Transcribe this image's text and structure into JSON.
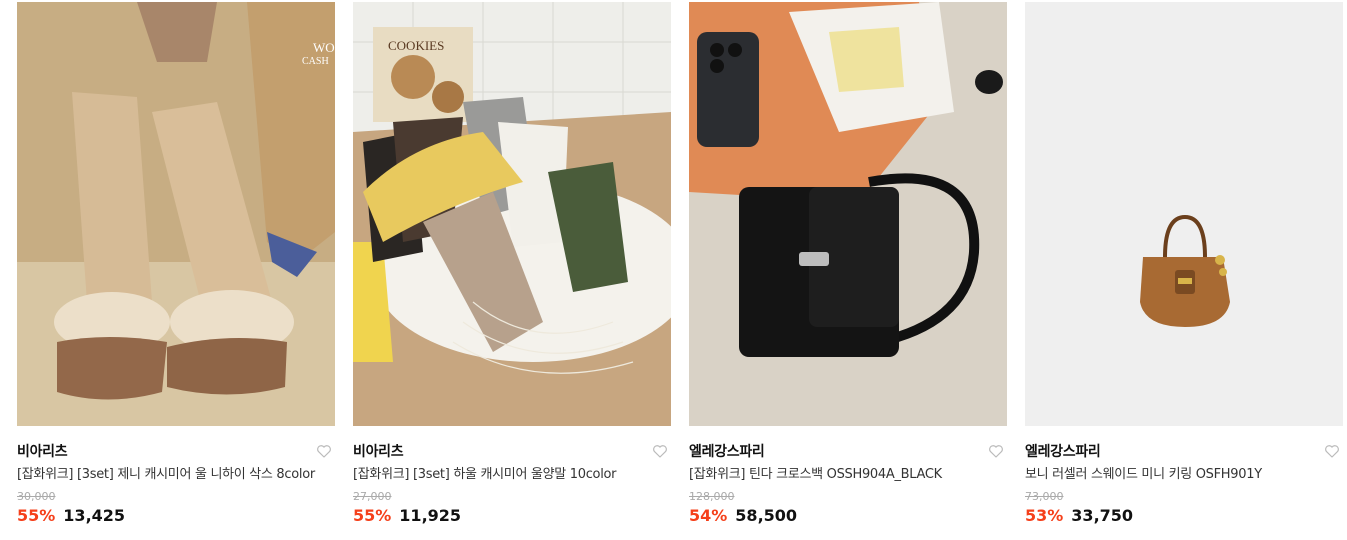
{
  "colors": {
    "discount": "#f5401b",
    "strike": "#aaaaaa",
    "text": "#111111"
  },
  "products": [
    {
      "brand": "비아리츠",
      "name": "[잡화위크] [3set] 제니 캐시미어 울 니하이 삭스 8color",
      "original_price": "30,000",
      "discount": "55%",
      "price": "13,425",
      "image": "socks-boots-photo",
      "overlay_text": [
        "WO",
        "CASH"
      ]
    },
    {
      "brand": "비아리츠",
      "name": "[잡화위크] [3set] 하울 캐시미어 울양말 10color",
      "original_price": "27,000",
      "discount": "55%",
      "price": "11,925",
      "image": "folded-socks-photo",
      "overlay_text": [
        "COOKIES"
      ]
    },
    {
      "brand": "엘레강스파리",
      "name": "[잡화위크] 틴다 크로스백 OSSH904A_BLACK",
      "original_price": "128,000",
      "discount": "54%",
      "price": "58,500",
      "image": "black-crossbag-photo"
    },
    {
      "brand": "엘레강스파리",
      "name": "보니 러셀러 스웨이드 미니 키링 OSFH901Y",
      "original_price": "73,000",
      "discount": "53%",
      "price": "33,750",
      "image": "mini-suede-bag-keyring-photo"
    }
  ],
  "icons": {
    "wishlist": "heart-outline-icon"
  }
}
